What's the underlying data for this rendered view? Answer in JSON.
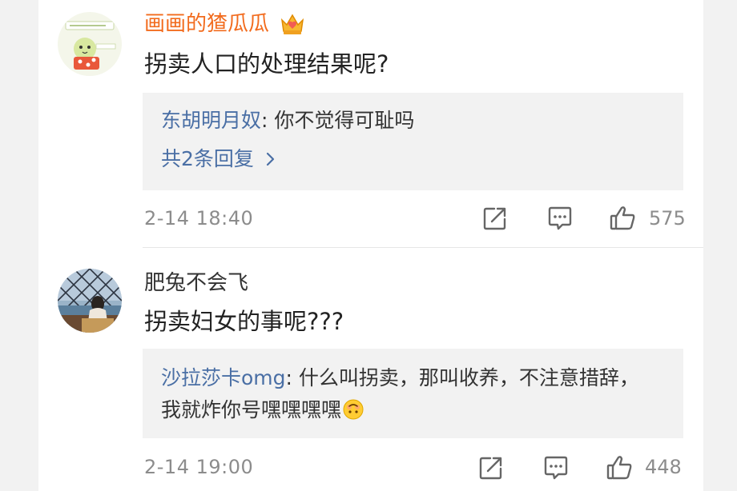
{
  "comments": [
    {
      "username": "画画的猹瓜瓜",
      "vip_badge_icon": "crown-vip-icon",
      "username_color": "#f26b1d",
      "content": "拐卖人口的处理结果呢?",
      "replies": [
        {
          "name": "东胡明月奴",
          "text": ": 你不觉得可耻吗"
        }
      ],
      "more_replies": "共2条回复",
      "timestamp": "2-14 18:40",
      "likes": "575"
    },
    {
      "username": "肥兔不会飞",
      "content": "拐卖妇女的事呢???",
      "replies": [
        {
          "name": "沙拉莎卡omg",
          "text": ": 什么叫拐卖，那叫收养，不注意措辞，",
          "continuation": "我就炸你号嘿嘿嘿嘿"
        }
      ],
      "reply_emoji": "upside-down-face-emoji",
      "timestamp": "2-14 19:00",
      "likes": "448"
    }
  ],
  "colors": {
    "link_blue": "#4a6fa5",
    "meta_gray": "#8c8c8c",
    "reply_bg": "#f2f2f2"
  }
}
